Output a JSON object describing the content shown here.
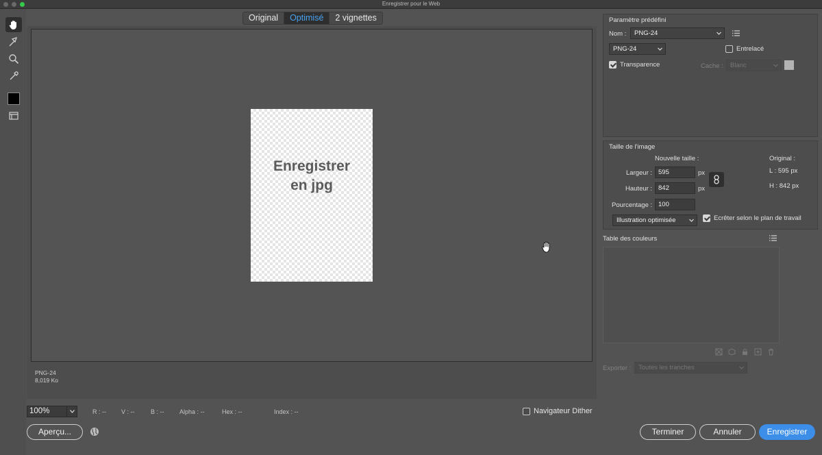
{
  "window": {
    "title": "Enregistrer pour le Web"
  },
  "tabs": [
    {
      "label": "Original",
      "active": false
    },
    {
      "label": "Optimisé",
      "active": true
    },
    {
      "label": "2 vignettes",
      "active": false
    }
  ],
  "toolbar": {
    "tools": [
      "hand-tool-icon",
      "slice-select-icon",
      "zoom-icon",
      "eyedropper-icon"
    ],
    "eyedropper_color": "#000000"
  },
  "canvas": {
    "doc_text_line1": "Enregistrer",
    "doc_text_line2": "en jpg",
    "format": "PNG-24",
    "size": "8,019 Ko"
  },
  "status": {
    "zoom": "100%",
    "r": "R : --",
    "v": "V : --",
    "b": "B : --",
    "alpha": "Alpha : --",
    "hex": "Hex : --",
    "index": "Index : --",
    "dither_label": "Navigateur Dither",
    "dither_checked": false
  },
  "buttons": {
    "preview": "Aperçu...",
    "done": "Terminer",
    "cancel": "Annuler",
    "save": "Enregistrer"
  },
  "preset": {
    "section_title": "Paramètre prédéfini",
    "name_label": "Nom :",
    "name_value": "PNG-24",
    "format_value": "PNG-24",
    "interlaced_label": "Entrelacé",
    "interlaced_checked": false,
    "transparency_label": "Transparence",
    "transparency_checked": true,
    "matte_label": "Cache :",
    "matte_value": "Blanc"
  },
  "image_size": {
    "section_title": "Taille de l'image",
    "new_size_label": "Nouvelle taille :",
    "original_label": "Original :",
    "width_label": "Largeur :",
    "width_value": "595",
    "height_label": "Hauteur :",
    "height_value": "842",
    "unit": "px",
    "percent_label": "Pourcentage :",
    "percent_value": "100",
    "orig_width": "L :   595 px",
    "orig_height": "H :   842 px",
    "quality_value": "Illustration optimisée",
    "clip_label": "Ecrêter selon le plan de travail",
    "clip_checked": true
  },
  "color_table": {
    "section_title": "Table des couleurs"
  },
  "export": {
    "label": "Exporter :",
    "value": "Toutes les tranches"
  }
}
